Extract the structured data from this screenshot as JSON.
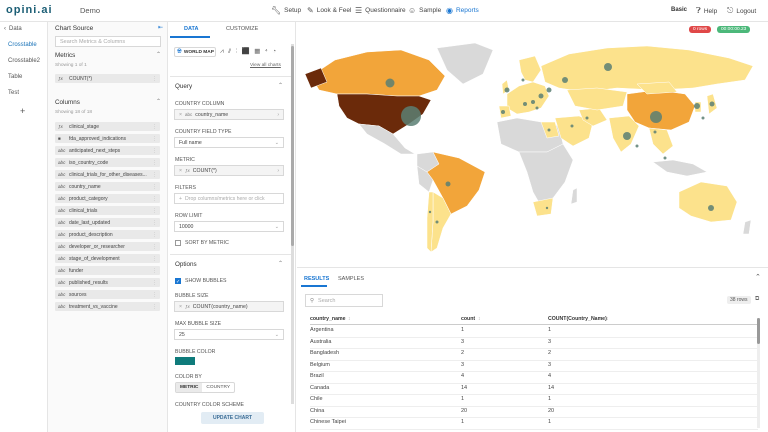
{
  "app": {
    "logo": "opini.ai",
    "workspace": "Demo"
  },
  "topnav": [
    {
      "label": "Setup",
      "icon": "wrench-icon"
    },
    {
      "label": "Look & Feel",
      "icon": "palette-icon"
    },
    {
      "label": "Questionnaire",
      "icon": "form-icon"
    },
    {
      "label": "Sample",
      "icon": "people-icon"
    },
    {
      "label": "Reports",
      "icon": "reports-icon"
    }
  ],
  "topright": {
    "plan": "Basic",
    "help": "Help",
    "logout": "Logout"
  },
  "leftnav": [
    "Data",
    "Crosstable",
    "Crosstable2",
    "Table",
    "Test"
  ],
  "leftnav_add": "+",
  "source": {
    "title": "Chart Source",
    "search_placeholder": "Search Metrics & Columns",
    "metrics_title": "Metrics",
    "metrics_count": "Showing 1 of 1",
    "metrics": [
      "COUNT(*)"
    ],
    "columns_title": "Columns",
    "columns_count": "Showing 18 of 18",
    "columns": [
      {
        "type": "ƒx",
        "name": "clinical_stage"
      },
      {
        "type": "■",
        "name": "fda_approved_indications"
      },
      {
        "type": "abc",
        "name": "anticipated_next_steps"
      },
      {
        "type": "abc",
        "name": "iso_country_code"
      },
      {
        "type": "abc",
        "name": "clinical_trials_for_other_diseases..."
      },
      {
        "type": "abc",
        "name": "country_name"
      },
      {
        "type": "abc",
        "name": "product_category"
      },
      {
        "type": "abc",
        "name": "clinical_trials"
      },
      {
        "type": "abc",
        "name": "date_last_updated"
      },
      {
        "type": "abc",
        "name": "product_description"
      },
      {
        "type": "abc",
        "name": "developer_or_researcher"
      },
      {
        "type": "abc",
        "name": "stage_of_development"
      },
      {
        "type": "abc",
        "name": "funder"
      },
      {
        "type": "abc",
        "name": "published_results"
      },
      {
        "type": "abc",
        "name": "sources"
      },
      {
        "type": "abc",
        "name": "treatment_vs_vaccine"
      }
    ]
  },
  "config": {
    "tabs": [
      "DATA",
      "CUSTOMIZE"
    ],
    "chart_type": "WORLD MAP",
    "view_all": "View all charts",
    "query_title": "Query",
    "country_column_label": "COUNTRY COLUMN",
    "country_column_value": "country_name",
    "country_field_type_label": "COUNTRY FIELD TYPE",
    "country_field_type_value": "Full name",
    "metric_label": "METRIC",
    "metric_value": "COUNT(*)",
    "filters_label": "FILTERS",
    "filters_placeholder": "Drop columns/metrics here or click",
    "row_limit_label": "ROW LIMIT",
    "row_limit_value": "10000",
    "sort_by_metric": "SORT BY METRIC",
    "options_title": "Options",
    "show_bubbles": "SHOW BUBBLES",
    "bubble_size_label": "BUBBLE SIZE",
    "bubble_size_value": "COUNT(country_name)",
    "max_bubble_label": "MAX BUBBLE SIZE",
    "max_bubble_value": "25",
    "bubble_color_label": "BUBBLE COLOR",
    "bubble_color": "#0f7b7b",
    "color_by_label": "COLOR BY",
    "color_by_options": [
      "METRIC",
      "COUNTRY"
    ],
    "country_color_scheme_label": "COUNTRY COLOR SCHEME",
    "update_button": "UPDATE CHART"
  },
  "map": {
    "rows_badge": "0 rows",
    "time_badge": "00:00:00.23",
    "colors": {
      "high": "#6b2a0a",
      "mid": "#f2a53a",
      "low": "#fce28c",
      "none": "#d9d9d9",
      "bubble": "#5a7f73"
    }
  },
  "results": {
    "tabs": [
      "RESULTS",
      "SAMPLES"
    ],
    "search_placeholder": "Search",
    "rows_label": "38 rows",
    "columns": [
      "country_name",
      "count",
      "COUNT(Country_Name)"
    ],
    "rows": [
      [
        "Argentina",
        "1",
        "1"
      ],
      [
        "Australia",
        "3",
        "3"
      ],
      [
        "Bangladesh",
        "2",
        "2"
      ],
      [
        "Belgium",
        "3",
        "3"
      ],
      [
        "Brazil",
        "4",
        "4"
      ],
      [
        "Canada",
        "14",
        "14"
      ],
      [
        "Chile",
        "1",
        "1"
      ],
      [
        "China",
        "20",
        "20"
      ],
      [
        "Chinese Taipei",
        "1",
        "1"
      ]
    ]
  }
}
